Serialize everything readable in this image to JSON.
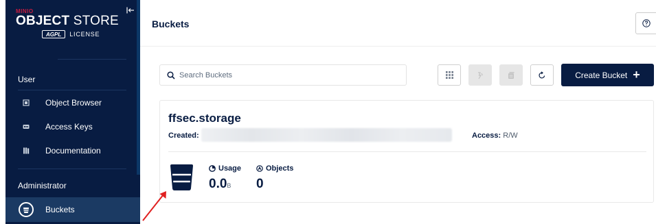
{
  "brand": {
    "vendor": "MINIO",
    "title_bold": "OBJECT",
    "title_light": " STORE",
    "agpl": "AGPL",
    "license": "LICENSE"
  },
  "sidebar": {
    "sections": [
      {
        "label": "User",
        "items": [
          {
            "label": "Object Browser",
            "icon": "object-browser-icon"
          },
          {
            "label": "Access Keys",
            "icon": "access-keys-icon"
          },
          {
            "label": "Documentation",
            "icon": "documentation-icon"
          }
        ]
      },
      {
        "label": "Administrator",
        "items": [
          {
            "label": "Buckets",
            "icon": "bucket-icon",
            "active": true
          }
        ]
      }
    ]
  },
  "header": {
    "title": "Buckets",
    "help_icon": "help-icon"
  },
  "toolbar": {
    "search_placeholder": "Search Buckets",
    "search_value": "",
    "create_label": "Create Bucket",
    "create_icon": "plus-icon"
  },
  "bucket": {
    "name": "ffsec.storage",
    "created_label": "Created:",
    "created_value_redacted": true,
    "access_label": "Access:",
    "access_value": "R/W",
    "usage_label": "Usage",
    "usage_value": "0.0",
    "usage_unit": "B",
    "objects_label": "Objects",
    "objects_value": "0"
  },
  "colors": {
    "sidebar_bg": "#081c42",
    "active_item_bg": "#1b3a63",
    "primary": "#081c42",
    "brand_red": "#c51b3f",
    "annotation_arrow": "#e02020"
  }
}
